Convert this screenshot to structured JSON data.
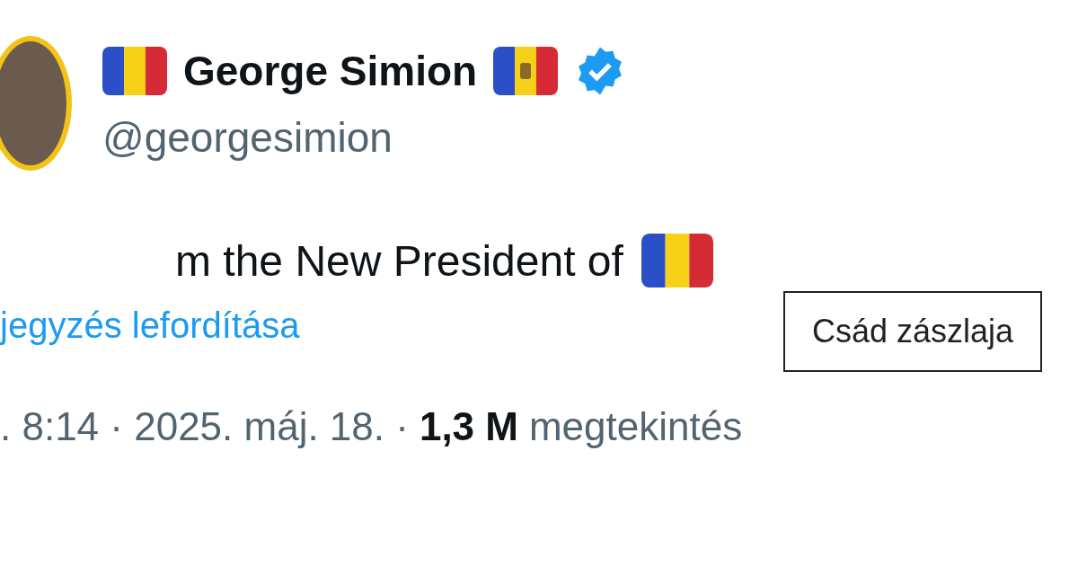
{
  "author": {
    "name": "George Simion",
    "handle": "@georgesimion",
    "verified": true
  },
  "tweet": {
    "text": "m the New President of",
    "translate_link": "jegyzés lefordítása"
  },
  "tooltip": {
    "text": "Csád zászlaja"
  },
  "meta": {
    "time": ". 8:14 · 2025. máj. 18. ·",
    "views_count": "1,3 M",
    "views_label": "megtekintés"
  }
}
